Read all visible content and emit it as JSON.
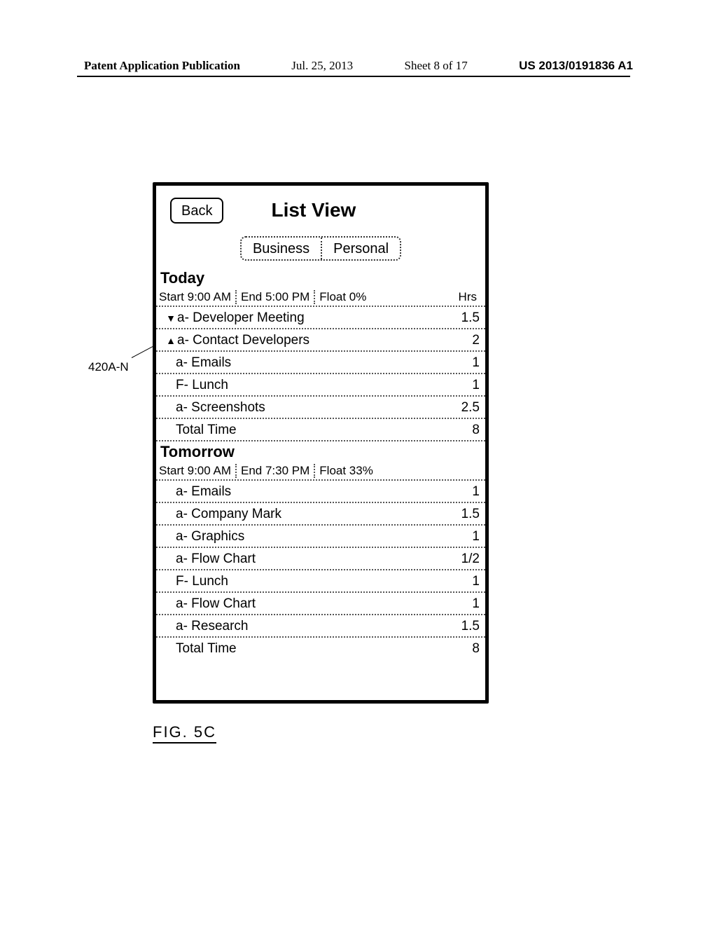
{
  "header": {
    "publication": "Patent Application Publication",
    "date": "Jul. 25, 2013",
    "sheet": "Sheet 8 of 17",
    "pubnum": "US 2013/0191836 A1"
  },
  "callout": "420A-N",
  "figure_label": "FIG. 5C",
  "screen": {
    "back_label": "Back",
    "title": "List View",
    "segments": {
      "business": "Business",
      "personal": "Personal"
    },
    "hrs_label": "Hrs",
    "today": {
      "heading": "Today",
      "start": "Start 9:00 AM",
      "end": "End 5:00 PM",
      "float": "Float 0%",
      "rows": [
        {
          "marker": "▼",
          "label": "a- Developer Meeting",
          "hrs": "1.5"
        },
        {
          "marker": "▲",
          "label": "a- Contact Developers",
          "hrs": "2"
        },
        {
          "marker": "",
          "label": "a- Emails",
          "hrs": "1"
        },
        {
          "marker": "",
          "label": "F- Lunch",
          "hrs": "1"
        },
        {
          "marker": "",
          "label": "a- Screenshots",
          "hrs": "2.5"
        },
        {
          "marker": "",
          "label": "Total Time",
          "hrs": "8"
        }
      ]
    },
    "tomorrow": {
      "heading": "Tomorrow",
      "start": "Start 9:00 AM",
      "end": "End 7:30 PM",
      "float": "Float 33%",
      "rows": [
        {
          "label": "a- Emails",
          "hrs": "1"
        },
        {
          "label": "a- Company Mark",
          "hrs": "1.5"
        },
        {
          "label": "a- Graphics",
          "hrs": "1"
        },
        {
          "label": "a- Flow Chart",
          "hrs": "1/2"
        },
        {
          "label": "F- Lunch",
          "hrs": "1"
        },
        {
          "label": "a- Flow Chart",
          "hrs": "1"
        },
        {
          "label": "a- Research",
          "hrs": "1.5"
        },
        {
          "label": "Total Time",
          "hrs": "8"
        }
      ]
    }
  }
}
